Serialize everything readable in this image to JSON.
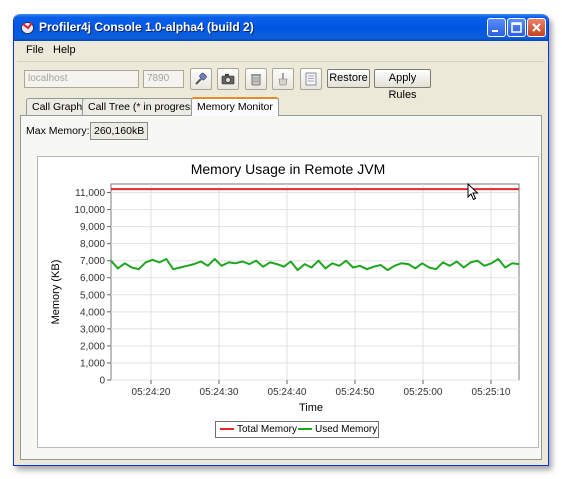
{
  "window": {
    "title": "Profiler4j Console 1.0-alpha4 (build 2)"
  },
  "menu": [
    {
      "label": "File"
    },
    {
      "label": "Help"
    }
  ],
  "toolbar": {
    "host": {
      "value": "localhost"
    },
    "port": {
      "value": "7890"
    },
    "restore_label": "Restore",
    "apply_rules_label": "Apply Rules",
    "icons": [
      "connect-icon",
      "snapshot-icon",
      "gc-icon",
      "clear-icon",
      "rules-icon"
    ]
  },
  "tabs": [
    {
      "label": "Call Graph",
      "active": false
    },
    {
      "label": "Call Tree (* in progress*)",
      "active": false
    },
    {
      "label": "Memory Monitor",
      "active": true
    }
  ],
  "memory": {
    "max_memory_label": "Max Memory:",
    "max_memory_value": "260,160kB"
  },
  "chart_data": {
    "type": "line",
    "title": "Memory Usage in Remote JVM",
    "xlabel": "Time",
    "ylabel": "Memory (KB)",
    "ylim": [
      0,
      11500
    ],
    "yticks": [
      "0",
      "1,000",
      "2,000",
      "3,000",
      "4,000",
      "5,000",
      "6,000",
      "7,000",
      "8,000",
      "9,000",
      "10,000",
      "11,000"
    ],
    "xticks": [
      "05:24:20",
      "05:24:30",
      "05:24:40",
      "05:24:50",
      "05:25:00",
      "05:25:10"
    ],
    "grid": true,
    "legend_position": "bottom",
    "series": [
      {
        "name": "Total Memory",
        "color": "#e8262a",
        "values": [
          11200,
          11200,
          11200,
          11200,
          11200,
          11200,
          11200,
          11200,
          11200,
          11200,
          11200,
          11200,
          11200,
          11200,
          11200,
          11200,
          11200,
          11200,
          11200,
          11200,
          11200,
          11200,
          11200,
          11200,
          11200,
          11200,
          11200,
          11200,
          11200,
          11200,
          11200,
          11200,
          11200,
          11200,
          11200,
          11200,
          11200,
          11200,
          11200,
          11200,
          11200,
          11200,
          11200,
          11200,
          11200,
          11200,
          11200,
          11200,
          11200,
          11200,
          11200,
          11200,
          11200,
          11200,
          11200,
          11200,
          11200,
          11200,
          11200,
          11200
        ]
      },
      {
        "name": "Used Memory",
        "color": "#1fa61f",
        "values": [
          7000,
          6550,
          6850,
          6600,
          6500,
          6900,
          7050,
          6900,
          7100,
          6500,
          6600,
          6700,
          6800,
          6950,
          6700,
          7100,
          6700,
          6900,
          6850,
          6950,
          6800,
          7000,
          6650,
          6900,
          6800,
          6650,
          6950,
          6450,
          6800,
          6600,
          7000,
          6550,
          6850,
          6700,
          7000,
          6600,
          6700,
          6500,
          6650,
          6750,
          6450,
          6700,
          6850,
          6800,
          6550,
          6850,
          6600,
          6500,
          6900,
          6700,
          6950,
          6600,
          6900,
          7000,
          6700,
          6850,
          7100,
          6600,
          6850,
          6800
        ]
      }
    ]
  },
  "colors": {
    "titlebar": "#0055e5",
    "window_bg": "#ece9d8",
    "active_tab_accent": "#e68b2c"
  }
}
